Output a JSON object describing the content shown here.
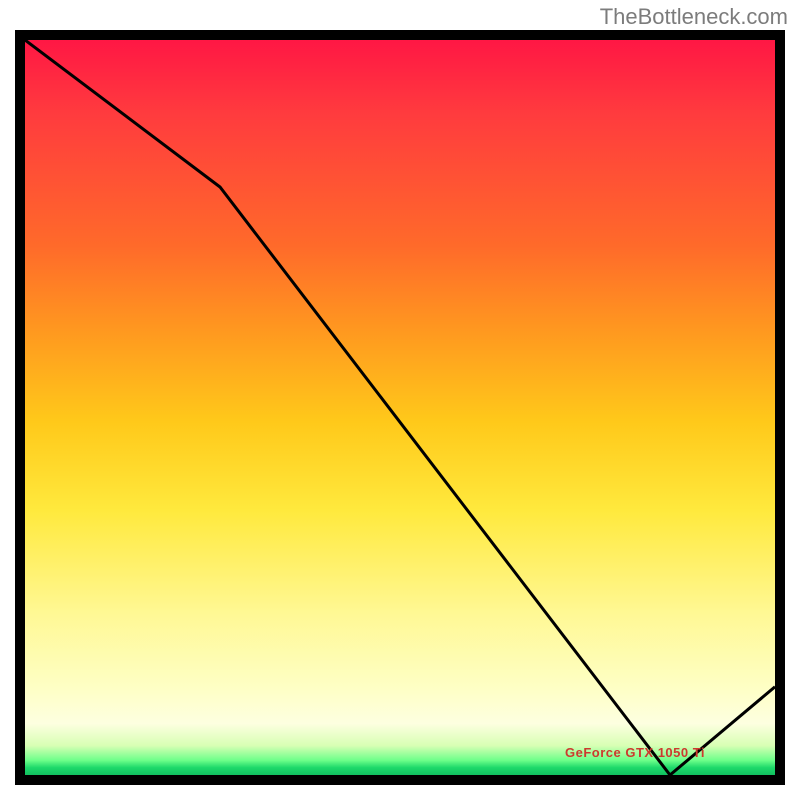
{
  "attribution": "TheBottleneck.com",
  "annotation_label": "GeForce GTX 1050 Ti",
  "chart_data": {
    "type": "line",
    "title": "",
    "xlabel": "",
    "ylabel": "",
    "xlim": [
      0,
      100
    ],
    "ylim": [
      0,
      100
    ],
    "grid": false,
    "legend": false,
    "x": [
      0,
      26,
      86,
      100
    ],
    "values": [
      100,
      80,
      0,
      12
    ],
    "annotations": [
      {
        "text": "GeForce GTX 1050 Ti",
        "x": 80,
        "y": 3
      }
    ],
    "background": "heat-gradient-red-to-green"
  }
}
